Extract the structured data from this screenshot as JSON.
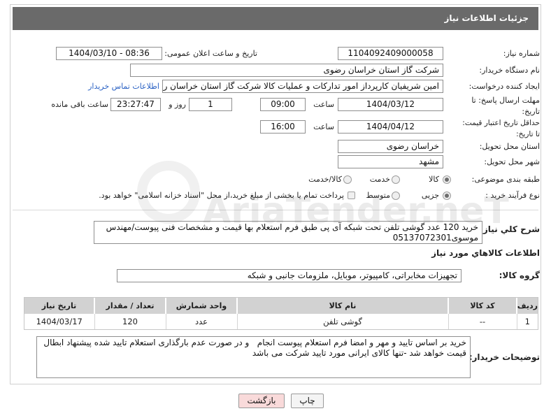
{
  "colors": {
    "header_bg": "#6a6a6a",
    "link": "#2b62c4",
    "back_button_bg": "#f9dada"
  },
  "page": {
    "title": "جزئیات اطلاعات نیاز",
    "watermark": "AriaTender.neT"
  },
  "need": {
    "number": {
      "label": "شماره نیاز:",
      "value": "1104092409000058"
    },
    "announce": {
      "label": "تاریخ و ساعت اعلان عمومی:",
      "value": "1404/03/10 - 08:36"
    },
    "buyer_org": {
      "label": "نام دستگاه خریدار:",
      "value": "شرکت گاز استان خراسان رضوی"
    },
    "requester": {
      "label": "ایجاد کننده درخواست:",
      "value": "امین شریفیان کارپرداز امور تدارکات و عملیات کالا شرکت گاز استان خراسان رضو",
      "contact_link": "اطلاعات تماس خریدار"
    },
    "response_deadline": {
      "label_line1": "مهلت ارسال پاسخ: تا",
      "label_line2": "تاریخ:",
      "date": "1404/03/12",
      "time_label": "ساعت",
      "time": "09:00",
      "days": "1",
      "days_label": "روز و",
      "remaining": "23:27:47",
      "remaining_label": "ساعت باقی مانده"
    },
    "price_validity": {
      "label_line1": "حداقل تاریخ اعتبار قیمت:",
      "label_line2": "تا تاریخ:",
      "date": "1404/04/12",
      "time_label": "ساعت",
      "time": "16:00"
    },
    "delivery_province": {
      "label": "استان محل تحویل:",
      "value": "خراسان رضوی"
    },
    "delivery_city": {
      "label": "شهر محل تحویل:",
      "value": "مشهد"
    },
    "subject_category": {
      "label": "طبقه بندی موضوعی:",
      "options": [
        {
          "label": "کالا",
          "checked": true
        },
        {
          "label": "خدمت",
          "checked": false
        },
        {
          "label": "کالا/خدمت",
          "checked": false
        }
      ]
    },
    "purchase_process": {
      "label": "نوع فرآیند خرید :",
      "options": [
        {
          "label": "جزیی",
          "checked": true
        },
        {
          "label": "متوسط",
          "checked": false
        }
      ],
      "treasury": {
        "label": "پرداخت تمام یا بخشی از مبلغ خرید،از محل \"اسناد خزانه اسلامی\" خواهد بود.",
        "checked": false
      }
    },
    "description": {
      "label": "شرح کلي نياز:",
      "value": "خرید 120 عدد گوشی تلفن تحت شبکه آی پی طبق فرم استعلام بها قیمت و مشخصات فنی پیوست/مهندس موسوی05137072301"
    }
  },
  "goods": {
    "title": "اطلاعات کالاهاي مورد نياز",
    "group_label": "گروه کالا:",
    "group_value": "تجهیزات مخابراتی، کامپیوتر، موبایل، ملزومات جانبی و شبکه",
    "table": {
      "headers": [
        "ردیف",
        "کد کالا",
        "نام کالا",
        "واحد شمارش",
        "تعداد / مقدار",
        "تاریخ نیاز"
      ],
      "rows": [
        [
          "1",
          "--",
          "گوشی تلفن",
          "عدد",
          "120",
          "1404/03/17"
        ]
      ]
    }
  },
  "buyer_notes": {
    "label": "توضیحات خریدار:",
    "value": "خرید بر اساس تایید و مهر و امضا فرم استعلام پیوست انجام   و در صورت عدم بارگذاری استعلام تایید شده پیشنهاد ابطال قیمت خواهد شد -تنها کالای ایرانی مورد تایید شرکت می باشد"
  },
  "buttons": {
    "print": "چاپ",
    "back": "بازگشت"
  }
}
